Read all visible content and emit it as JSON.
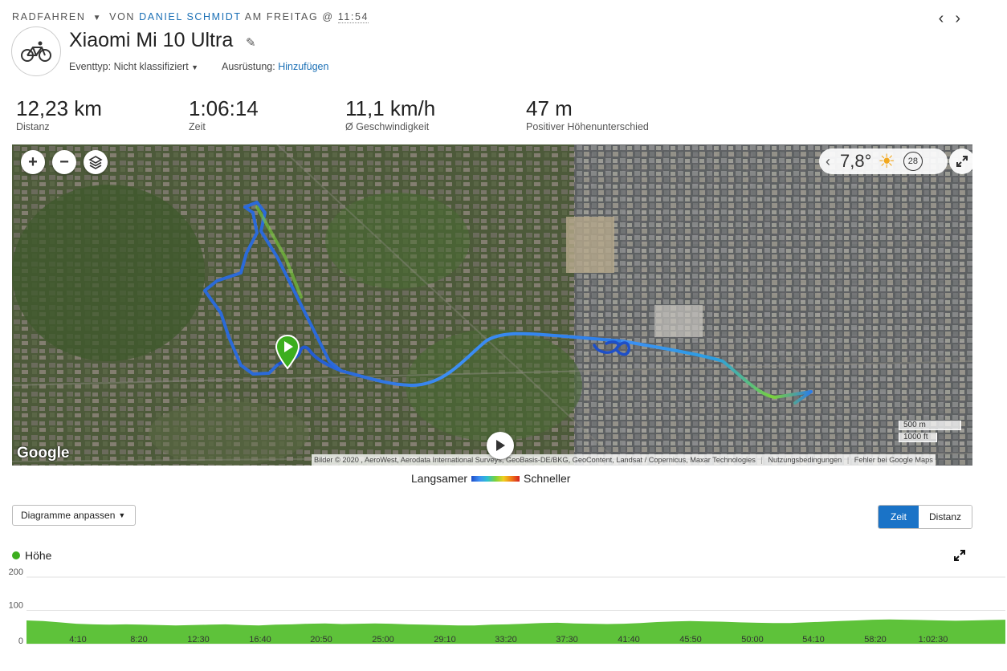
{
  "header": {
    "activity_type": "RADFAHREN",
    "by_text": "VON",
    "user": "DANIEL SCHMIDT",
    "day_text": "AM FREITAG @",
    "time": "11:54",
    "prev_icon": "chevron-left-icon",
    "next_icon": "chevron-right-icon"
  },
  "activity": {
    "icon": "bicycle-icon",
    "title": "Xiaomi Mi 10 Ultra",
    "event_type_label": "Eventtyp:",
    "event_type_value": "Nicht klassifiziert",
    "equipment_label": "Ausrüstung:",
    "equipment_link": "Hinzufügen"
  },
  "stats": [
    {
      "value": "12,23 km",
      "label": "Distanz"
    },
    {
      "value": "1:06:14",
      "label": "Zeit"
    },
    {
      "value": "11,1 km/h",
      "label": "Ø Geschwindigkeit"
    },
    {
      "value": "47 m",
      "label": "Positiver Höhenunterschied"
    }
  ],
  "map": {
    "zoom_in": "+",
    "zoom_out": "−",
    "temperature": "7,8°",
    "weather_icon": "sun-icon",
    "wind_speed": "28",
    "google_logo": "Google",
    "attribution": "Bilder © 2020 , AeroWest, Aerodata International Surveys, GeoBasis-DE/BKG, GeoContent, Landsat / Copernicus, Maxar Technologies",
    "terms": "Nutzungsbedingungen",
    "report": "Fehler bei Google Maps",
    "scale_metric": "500 m",
    "scale_imperial": "1000 ft",
    "colors": {
      "track_slow": "#1e4fc8",
      "track_mid": "#3d8ff5",
      "track_fast": "#7bd23a",
      "start_marker": "#3cae1e"
    }
  },
  "speed_legend": {
    "slow": "Langsamer",
    "fast": "Schneller"
  },
  "controls": {
    "customize_charts": "Diagramme anpassen",
    "toggle_time": "Zeit",
    "toggle_distance": "Distanz"
  },
  "chart_data": {
    "type": "area",
    "title": "Höhe",
    "series": [
      {
        "name": "Höhe",
        "color": "#5ec23a",
        "values": [
          70,
          68,
          64,
          60,
          58,
          57,
          58,
          57,
          56,
          55,
          56,
          57,
          58,
          56,
          55,
          57,
          58,
          60,
          61,
          59,
          60,
          61,
          60,
          58,
          57,
          56,
          55,
          55,
          57,
          58,
          60,
          62,
          63,
          61,
          60,
          59,
          60,
          62,
          65,
          67,
          68,
          67,
          66,
          64,
          63,
          62,
          62,
          64,
          66,
          68,
          70,
          72,
          73,
          72,
          71,
          70,
          69,
          70,
          71,
          72
        ]
      }
    ],
    "x_tick_labels": [
      "4:10",
      "8:20",
      "12:30",
      "16:40",
      "20:50",
      "25:00",
      "29:10",
      "33:20",
      "37:30",
      "41:40",
      "45:50",
      "50:00",
      "54:10",
      "58:20",
      "1:02:30"
    ],
    "y_tick_labels": [
      "200",
      "100",
      "0"
    ],
    "ylim": [
      0,
      200
    ],
    "grid": true
  }
}
